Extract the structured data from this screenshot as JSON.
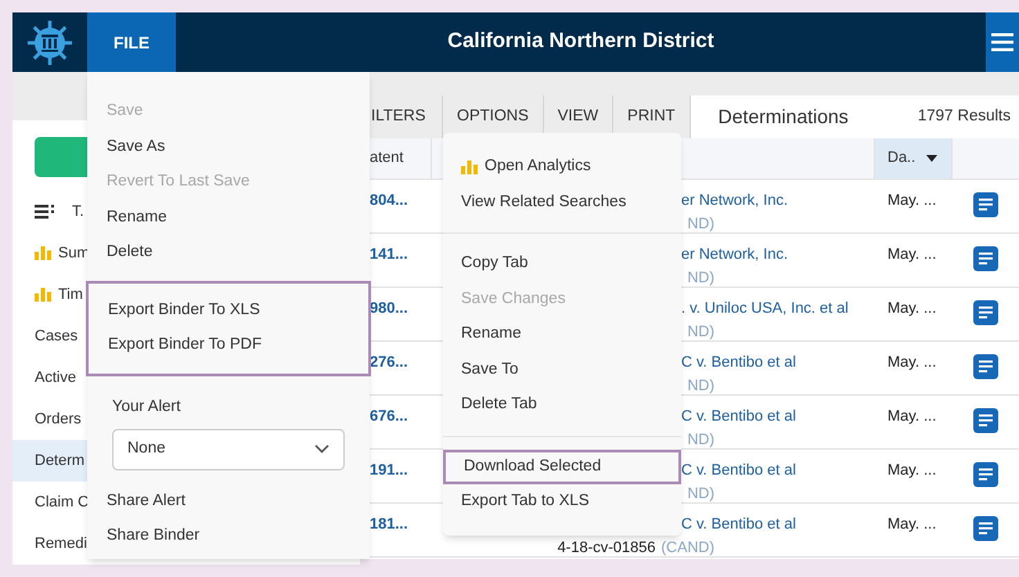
{
  "header": {
    "title": "California Northern District",
    "file_tab": {
      "label": "FILE",
      "selected": true
    }
  },
  "sidebar": {
    "items": [
      {
        "kind": "list",
        "label": "T.",
        "selected": false
      },
      {
        "kind": "chart",
        "label": "Sum",
        "selected": false
      },
      {
        "kind": "chart",
        "label": "Tim",
        "selected": false
      },
      {
        "kind": "plain",
        "label": "Cases",
        "selected": false
      },
      {
        "kind": "plain",
        "label": "Active",
        "selected": false
      },
      {
        "kind": "plain",
        "label": "Orders",
        "selected": false
      },
      {
        "kind": "plain",
        "label": "Determ",
        "selected": true
      },
      {
        "kind": "plain",
        "label": "Claim C",
        "selected": false
      },
      {
        "kind": "plain",
        "label": "Remedi",
        "selected": false
      }
    ]
  },
  "toolbar": {
    "tabs": [
      "ILTERS",
      "OPTIONS",
      "VIEW",
      "PRINT"
    ],
    "view_title": "Determinations",
    "results": "1797 Results"
  },
  "table": {
    "columns": [
      {
        "label": "atent",
        "sorted": false
      },
      {
        "sorted": false
      },
      {
        "label": "Da..",
        "sorted": true
      }
    ],
    "rows": [
      {
        "patent": "804...",
        "title": "er Network, Inc.",
        "court": "ND)",
        "date": "May. ..."
      },
      {
        "patent": "141...",
        "title": "er Network, Inc.",
        "court": "ND)",
        "date": "May. ..."
      },
      {
        "patent": "980...",
        "title": ". v. Uniloc USA, Inc. et al",
        "court": "ND)",
        "date": "May. ..."
      },
      {
        "patent": "276...",
        "title": "C v. Bentibo et al",
        "court": "ND)",
        "date": "May. ..."
      },
      {
        "patent": "676...",
        "title": "C v. Bentibo et al",
        "court": "ND)",
        "date": "May. ..."
      },
      {
        "patent": "191...",
        "title": "C v. Bentibo et al",
        "court": "ND)",
        "date": "May. ..."
      },
      {
        "patent": "181...",
        "title": "C v. Bentibo et al",
        "docket": "4-18-cv-01856",
        "court": "(CAND)",
        "date": "May. ..."
      }
    ]
  },
  "file_menu": {
    "groups": [
      {
        "outlined": false,
        "items": [
          {
            "label": "Save",
            "disabled": true
          },
          {
            "label": "Save As",
            "disabled": false
          },
          {
            "label": "Revert To Last Save",
            "disabled": true
          },
          {
            "label": "Rename",
            "disabled": false
          },
          {
            "label": "Delete",
            "disabled": false
          }
        ]
      },
      {
        "outlined": true,
        "items": [
          {
            "label": "Export Binder To XLS",
            "disabled": false
          },
          {
            "label": "Export Binder To PDF",
            "disabled": false
          }
        ]
      }
    ],
    "alert": {
      "label": "Your Alert",
      "value": "None"
    },
    "share_items": [
      "Share Alert",
      "Share Binder"
    ]
  },
  "options_menu": {
    "groups": [
      {
        "items": [
          {
            "label": "Open Analytics",
            "kind": "chart",
            "disabled": false,
            "outlined": false
          },
          {
            "label": "View Related Searches",
            "kind": "plain",
            "disabled": false,
            "outlined": false
          }
        ]
      },
      {
        "items": [
          {
            "label": "Copy Tab",
            "kind": "plain",
            "disabled": false,
            "outlined": false
          },
          {
            "label": "Save Changes",
            "kind": "plain",
            "disabled": true,
            "outlined": false
          },
          {
            "label": "Rename",
            "kind": "plain",
            "disabled": false,
            "outlined": false
          },
          {
            "label": "Save To",
            "kind": "plain",
            "disabled": false,
            "outlined": false
          },
          {
            "label": "Delete Tab",
            "kind": "plain",
            "disabled": false,
            "outlined": false
          }
        ]
      },
      {
        "items": [
          {
            "label": "Download Selected",
            "kind": "plain",
            "disabled": false,
            "outlined": true
          },
          {
            "label": "Export Tab to XLS",
            "kind": "plain",
            "disabled": false,
            "outlined": false
          }
        ]
      }
    ]
  }
}
